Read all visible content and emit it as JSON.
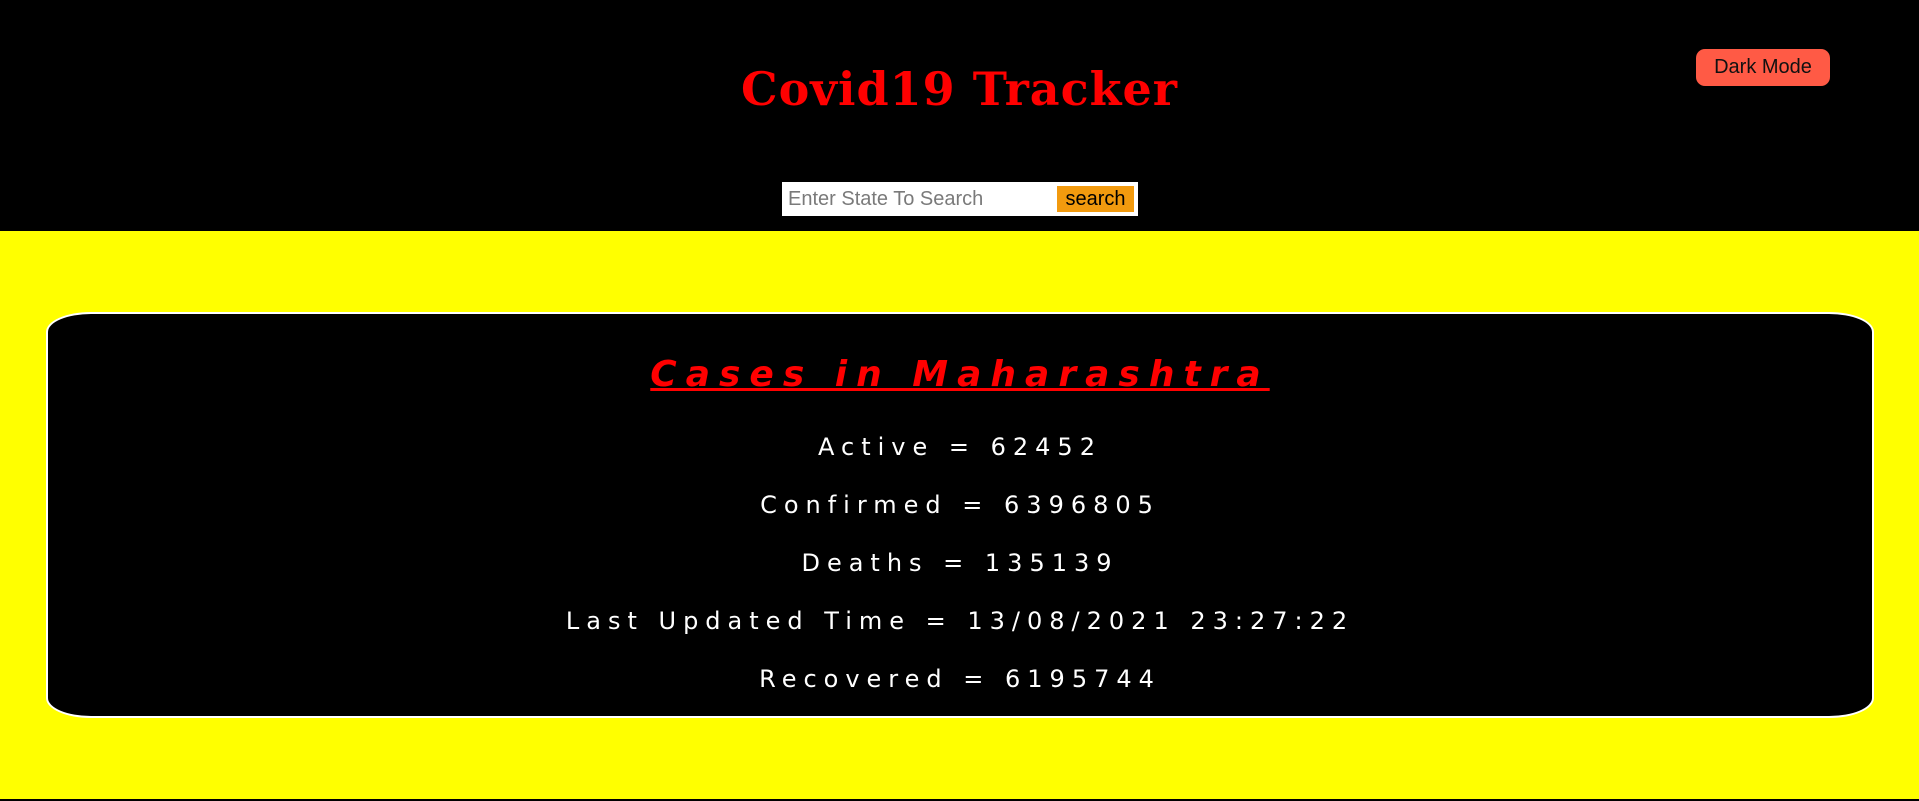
{
  "header": {
    "title": "Covid19 Tracker",
    "dark_mode_label": "Dark Mode"
  },
  "search": {
    "placeholder": "Enter State To Search",
    "value": "",
    "button_label": "search"
  },
  "card": {
    "title": "Cases in Maharashtra",
    "stats": [
      "Active = 62452",
      "Confirmed = 6396805",
      "Deaths = 135139",
      "Last Updated Time = 13/08/2021 23:27:22",
      "Recovered = 6195744"
    ]
  },
  "colors": {
    "header_bg": "#000000",
    "page_bg": "#ffff00",
    "title_red": "#ff0000",
    "dark_mode_button": "#ff5a45",
    "search_button": "#f29a0e",
    "card_bg": "#000000",
    "card_border": "#ffffff"
  }
}
